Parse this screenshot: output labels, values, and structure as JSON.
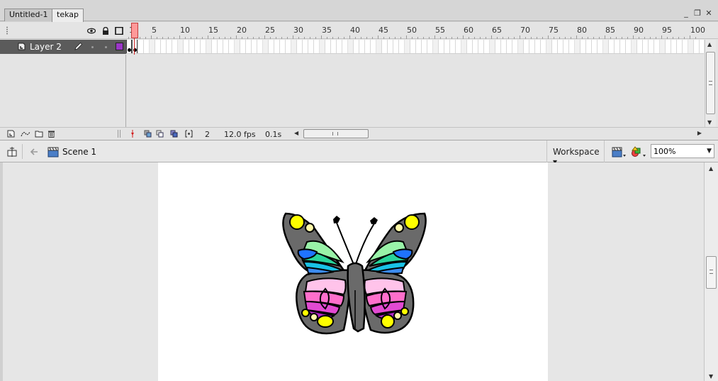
{
  "doc_tabs": [
    {
      "label": "Untitled-1",
      "active": false
    },
    {
      "label": "tekap",
      "active": true
    }
  ],
  "window_controls": {
    "minimize": "_",
    "restore": "❐",
    "close": "✕"
  },
  "timeline": {
    "header_icons": [
      "eye-icon",
      "lock-icon",
      "outline-icon"
    ],
    "ruler_labels": [
      "1",
      "5",
      "10",
      "15",
      "20",
      "25",
      "30",
      "35",
      "40",
      "45",
      "50",
      "55",
      "60",
      "65",
      "70",
      "75",
      "80",
      "85",
      "90",
      "95",
      "100"
    ],
    "current_frame_marker": "1",
    "layers": [
      {
        "name": "Layer 2",
        "selected": true,
        "color": "#9b36c7"
      }
    ],
    "footer": {
      "current_frame": "2",
      "frame_rate": "12.0 fps",
      "elapsed_time": "0.1s"
    }
  },
  "editbar": {
    "scene_label": "Scene 1",
    "workspace_label": "Workspace ▾",
    "zoom_value": "100%"
  },
  "stage": {
    "background": "#ffffff",
    "butterfly": {
      "body_color": "#6a6a6a",
      "colors": [
        "#ffff00",
        "#00cc66",
        "#1f8fff",
        "#19c2e6",
        "#ff66cc",
        "#cc33cc",
        "#9b36c7",
        "#ffe6f4"
      ]
    }
  }
}
